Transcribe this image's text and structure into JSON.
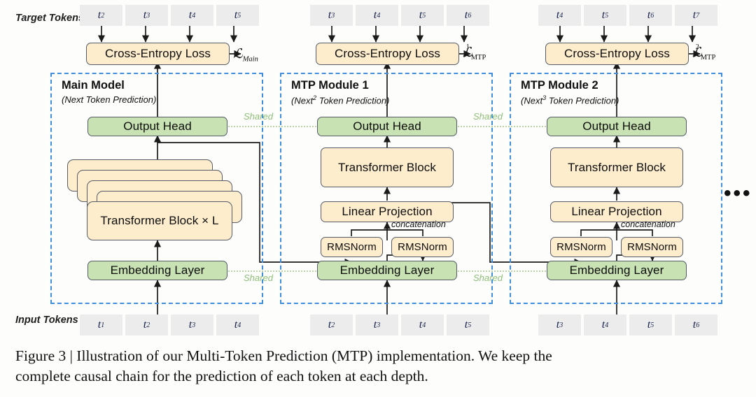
{
  "figure": {
    "row_labels": {
      "target": "Target Tokens",
      "input": "Input Tokens"
    },
    "ellipsis": "•••",
    "shared_label": "Shared",
    "concat_label": "concatenation",
    "columns": [
      {
        "id": "main",
        "frame_title": "Main Model",
        "frame_subtitle_pre": "(Next Token Prediction)",
        "frame_subtitle_sup": "",
        "loss_box": "Cross-Entropy Loss",
        "loss_symbol": {
          "cal": "ℒ",
          "sup": "",
          "sub": "Main",
          "sub_italic": true
        },
        "target_tokens": [
          "t2",
          "t3",
          "t4",
          "t5"
        ],
        "input_tokens": [
          "t1",
          "t2",
          "t3",
          "t4"
        ],
        "blocks": {
          "output_head": "Output Head",
          "transformer": "Transformer Block × L",
          "embedding": "Embedding Layer"
        }
      },
      {
        "id": "mtp1",
        "frame_title": "MTP Module 1",
        "frame_subtitle_pre": "(Next",
        "frame_subtitle_sup": "2",
        "frame_subtitle_post": " Token Prediction)",
        "loss_box": "Cross-Entropy Loss",
        "loss_symbol": {
          "cal": "ℒ",
          "sup": "1",
          "sub": "MTP",
          "sub_italic": false
        },
        "target_tokens": [
          "t3",
          "t4",
          "t5",
          "t6"
        ],
        "input_tokens": [
          "t2",
          "t3",
          "t4",
          "t5"
        ],
        "blocks": {
          "output_head": "Output Head",
          "transformer": "Transformer Block",
          "linear": "Linear Projection",
          "rmsnorm_left": "RMSNorm",
          "rmsnorm_right": "RMSNorm",
          "embedding": "Embedding Layer"
        }
      },
      {
        "id": "mtp2",
        "frame_title": "MTP Module 2",
        "frame_subtitle_pre": "(Next",
        "frame_subtitle_sup": "3",
        "frame_subtitle_post": " Token Prediction)",
        "loss_box": "Cross-Entropy Loss",
        "loss_symbol": {
          "cal": "ℒ",
          "sup": "2",
          "sub": "MTP",
          "sub_italic": false
        },
        "target_tokens": [
          "t4",
          "t5",
          "t6",
          "t7"
        ],
        "input_tokens": [
          "t3",
          "t4",
          "t5",
          "t6"
        ],
        "blocks": {
          "output_head": "Output Head",
          "transformer": "Transformer Block",
          "linear": "Linear Projection",
          "rmsnorm_left": "RMSNorm",
          "rmsnorm_right": "RMSNorm",
          "embedding": "Embedding Layer"
        }
      }
    ],
    "colors": {
      "green_fill": "#c8e2b3",
      "yellow_fill": "#fdedcd",
      "box_border": "#555a66",
      "frame_dash": "#3f8ede",
      "shared_green": "#8fbf78",
      "token_fill": "#ececec"
    }
  },
  "caption": {
    "line1": "Figure 3 | Illustration of our Multi-Token Prediction (MTP) implementation.  We keep the",
    "line2": "complete causal chain for the prediction of each token at each depth."
  }
}
